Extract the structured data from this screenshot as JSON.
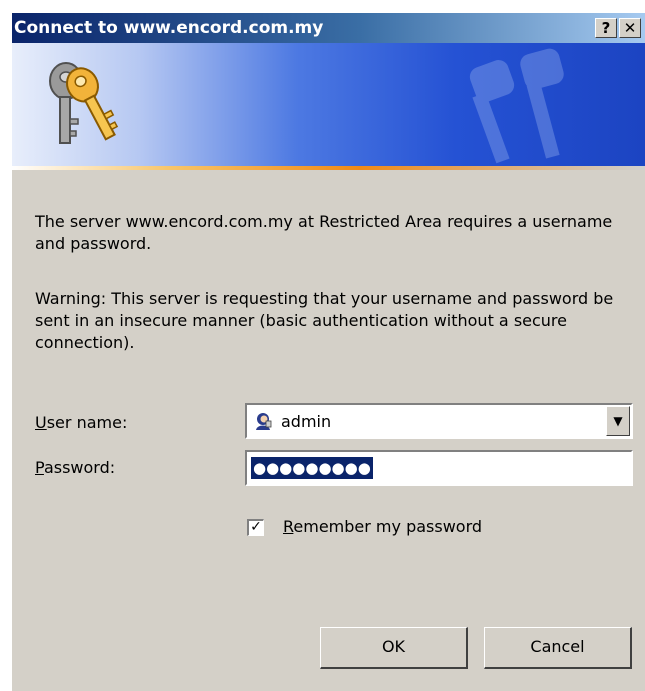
{
  "window": {
    "title": "Connect to www.encord.com.my",
    "help_label": "?",
    "close_label": "✕"
  },
  "message": {
    "line1": "The server www.encord.com.my at Restricted Area requires a username and password.",
    "line2": "Warning: This server is requesting that your username and password be sent in an insecure manner (basic authentication without a secure connection)."
  },
  "form": {
    "username_label_accel": "U",
    "username_label_rest": "ser name:",
    "username_value": "admin",
    "password_label_accel": "P",
    "password_label_rest": "assword:",
    "password_value": "●●●●●●●●●",
    "remember_accel": "R",
    "remember_rest": "emember my password",
    "remember_checked": true
  },
  "buttons": {
    "ok": "OK",
    "cancel": "Cancel"
  },
  "icons": {
    "banner": "keys-icon",
    "user": "user-icon",
    "dropdown": "dropdown-arrow-icon"
  },
  "colors": {
    "titlebar_start": "#0a246a",
    "dialog_bg": "#d4d0c8",
    "selection": "#0a246a"
  }
}
